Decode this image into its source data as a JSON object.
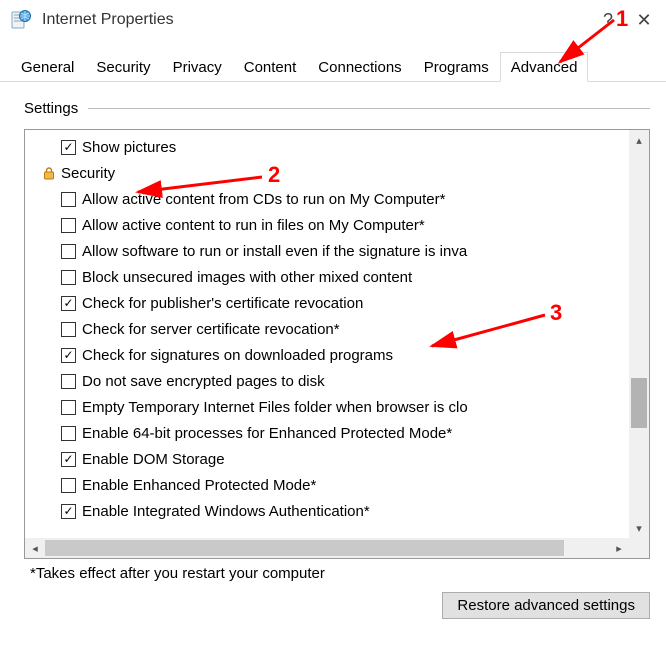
{
  "window": {
    "title": "Internet Properties",
    "help_symbol": "?",
    "close_symbol": "✕"
  },
  "tabs": [
    {
      "label": "General"
    },
    {
      "label": "Security"
    },
    {
      "label": "Privacy"
    },
    {
      "label": "Content"
    },
    {
      "label": "Connections"
    },
    {
      "label": "Programs"
    },
    {
      "label": "Advanced",
      "active": true
    }
  ],
  "section_label": "Settings",
  "first_item": {
    "label": "Show pictures",
    "checked": true
  },
  "category": {
    "label": "Security"
  },
  "items": [
    {
      "label": "Allow active content from CDs to run on My Computer*",
      "checked": false
    },
    {
      "label": "Allow active content to run in files on My Computer*",
      "checked": false
    },
    {
      "label": "Allow software to run or install even if the signature is inva",
      "checked": false
    },
    {
      "label": "Block unsecured images with other mixed content",
      "checked": false
    },
    {
      "label": "Check for publisher's certificate revocation",
      "checked": true
    },
    {
      "label": "Check for server certificate revocation*",
      "checked": false
    },
    {
      "label": "Check for signatures on downloaded programs",
      "checked": true
    },
    {
      "label": "Do not save encrypted pages to disk",
      "checked": false
    },
    {
      "label": "Empty Temporary Internet Files folder when browser is clo",
      "checked": false
    },
    {
      "label": "Enable 64-bit processes for Enhanced Protected Mode*",
      "checked": false
    },
    {
      "label": "Enable DOM Storage",
      "checked": true
    },
    {
      "label": "Enable Enhanced Protected Mode*",
      "checked": false
    },
    {
      "label": "Enable Integrated Windows Authentication*",
      "checked": true
    }
  ],
  "footer_note": "*Takes effect after you restart your computer",
  "restore_button": "Restore advanced settings",
  "annotations": {
    "n1": "1",
    "n2": "2",
    "n3": "3"
  }
}
